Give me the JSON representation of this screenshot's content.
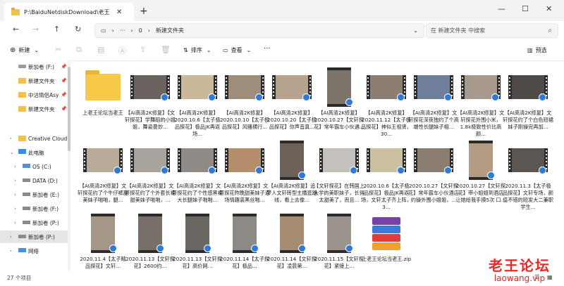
{
  "tab": {
    "title": "P:\\BaiduNetdiskDownload\\老王"
  },
  "address": {
    "path_part1": "0",
    "path_part2": "新建文件夹"
  },
  "search": {
    "placeholder": "在 新建文件夹 中搜索"
  },
  "toolbar": {
    "new_label": "新建",
    "sort_label": "排序",
    "view_label": "查看",
    "more_label": "···",
    "preview_label": "预选"
  },
  "sidebar": {
    "items": [
      {
        "label": "新加卷 (F:)",
        "icon": "drive-icon"
      },
      {
        "label": "新建文件夹",
        "icon": "folder-icon"
      },
      {
        "label": "中沽情侣Asy",
        "icon": "folder-icon"
      },
      {
        "label": "新建文件夹",
        "icon": "folder-icon"
      },
      {
        "label": "Creative Cloud",
        "icon": "folder-icon"
      },
      {
        "label": "此电脑",
        "icon": "pc-icon"
      },
      {
        "label": "OS (C:)",
        "icon": "drive-icon"
      },
      {
        "label": "DATA (D:)",
        "icon": "drive-icon"
      },
      {
        "label": "新加卷 (E:)",
        "icon": "drive-icon"
      },
      {
        "label": "新加卷 (F:)",
        "icon": "drive-icon"
      },
      {
        "label": "新加卷 (P:)",
        "icon": "drive-icon"
      },
      {
        "label": "新加卷 (P:)",
        "icon": "drive-icon"
      },
      {
        "label": "网络",
        "icon": "network-icon"
      }
    ]
  },
  "files": [
    {
      "name": "上老王论坛当老王"
    },
    {
      "name": "【AI高清2K修复】【文轩探花】学舞蹈的小姐姐，舞姿曼妙..."
    },
    {
      "name": "【AI高清2K修复】2020.10.6【太子极品探花】极品JK再返场..."
    },
    {
      "name": "【AI高清2K修复】2020.10.10【太子极品探花】风骚横行..."
    },
    {
      "name": "【AI高清2K修复】2020.10.20【太子极品探花】你声音真..."
    },
    {
      "name": "【AI高清2K修复】2020.10.27【文轩探花】常年霸车小伙遇..."
    },
    {
      "name": "【AI高清2K修复】2020.11.12【太子极品探花】神似王祖贤，30..."
    },
    {
      "name": "【AI高清2K修复】文轩探花深夜独约了个高端性长腿妹子相..."
    },
    {
      "name": "【AI高清2K修复】文轩探花外围小米，1.8k极致性价比高颜..."
    },
    {
      "name": "【AI高清2K修复】文轩探花约了个白色短裙妹子刚操完再加..."
    },
    {
      "name": "【AI高清2K修复】文轩探花约了个牛仔裤甜美妹子啪啪，腿..."
    },
    {
      "name": "【AI高清2K修复】文轩探花约了个外套长裙甜美妹子啪啪，..."
    },
    {
      "name": "【AI高清2K修复】文轩探花约了个性感黑裙大长腿妹子啪啪..."
    },
    {
      "name": "【AI高清2K修复】文轩探花昨晚甜美妹子返场情趣装黑丝啪..."
    },
    {
      "name": "【AI高清2K修复】追梦人文轩砖型主播逛路线，看上去像..."
    },
    {
      "name": "【文轩探花】在韩国上大学的美职妹子，长得太甜美了，而且..."
    },
    {
      "name": "2020.10.6【太子极品探花】极品JK再返场，文轩太子齐上阵，3..."
    },
    {
      "name": "2020.10.27【文轩探花】常年霸车小伙酒店约操外围小姐姐，..."
    },
    {
      "name": "2020.10.27【文轩探花】带小姐姐到酒店 让她给我手摸5次 口..."
    },
    {
      "name": "2020.11.3【太子极品探花】文轩专场，颜值不错的短发大二兼职学生..."
    },
    {
      "name": "2020.11.4【太子精品探花】文轩..."
    },
    {
      "name": "2020.11.13【文轩探花】2600约..."
    },
    {
      "name": "2020.11.13【文轩探花】高价网..."
    },
    {
      "name": "2020.11.14【太子探花】极品..."
    },
    {
      "name": "2020.11.14【文轩探花】凌晨第..."
    },
    {
      "name": "2020.11.15【文轩探花】紧接上..."
    },
    {
      "name": "上老王论坛当老王.zip"
    }
  ],
  "status": {
    "count": "27 个项目"
  },
  "watermark": {
    "line1": "老王论坛",
    "line2": "laowang.vip"
  },
  "colors": {
    "folder": "#f7c948",
    "selection": "#e5e5e5",
    "accent": "#2e7bd6",
    "watermark": "#e52a2a"
  }
}
